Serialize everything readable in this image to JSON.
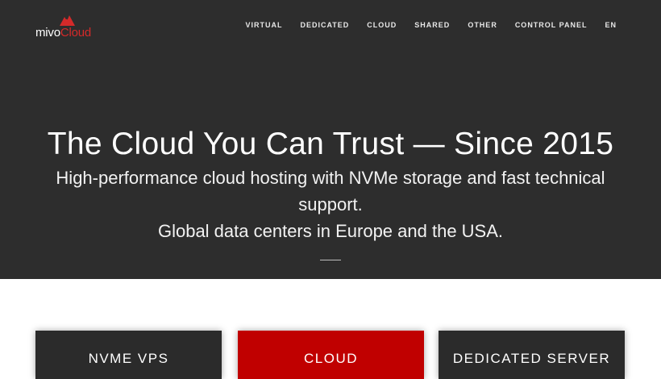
{
  "brand": {
    "name_part1": "mivo",
    "name_part2": "Cloud",
    "icon": "cloud-logo-icon",
    "accent_color": "#d42a2a"
  },
  "nav": {
    "items": [
      {
        "label": "VIRTUAL"
      },
      {
        "label": "DEDICATED"
      },
      {
        "label": "CLOUD"
      },
      {
        "label": "SHARED"
      },
      {
        "label": "OTHER"
      },
      {
        "label": "CONTROL PANEL"
      },
      {
        "label": "EN"
      }
    ]
  },
  "hero": {
    "title": "The Cloud You Can Trust — Since 2015",
    "subtitle_line1": "High-performance cloud hosting with NVMe storage and fast technical",
    "subtitle_line2": "support.",
    "subtitle_line3": "Global data centers in Europe and the USA.",
    "background_color": "#2d2d2d"
  },
  "cards": [
    {
      "label": "NVME VPS",
      "color": "#2b2b2b"
    },
    {
      "label": "CLOUD",
      "color": "#c00000"
    },
    {
      "label": "DEDICATED SERVER",
      "color": "#2b2b2b"
    }
  ]
}
